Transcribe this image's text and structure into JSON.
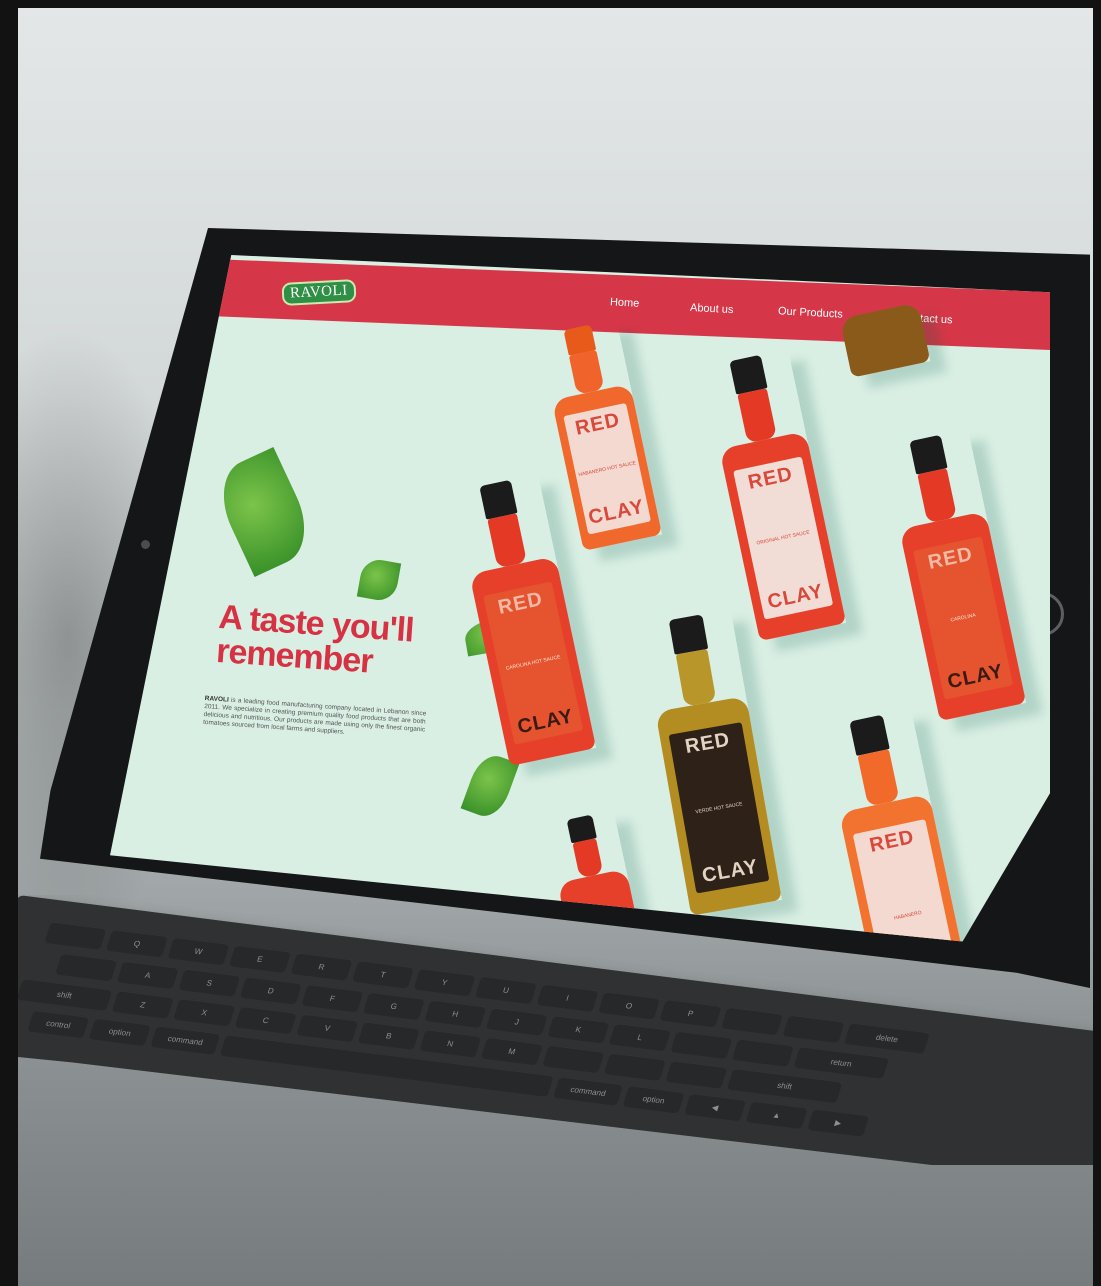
{
  "site": {
    "logo_text": "RAVOLI",
    "nav": [
      "Home",
      "About us",
      "Our Products",
      "Contact us"
    ],
    "hero": {
      "headline_line1": "A taste you'll",
      "headline_line2": "remember",
      "brand_name": "RAVOLI",
      "description": " is a leading food manufacturing company located in Lebanon since 2011. We specialize in creating premium quality food products that are both delicious and nutritious. Our products are made using only the finest organic tomatoes sourced from local farms and suppliers."
    },
    "bottles": [
      {
        "brand_top": "RED",
        "brand_bottom": "CLAY",
        "flavor": "HABANERO HOT SAUCE"
      },
      {
        "brand_top": "RED",
        "brand_bottom": "CLAY",
        "flavor": "ORIGINAL HOT SAUCE"
      },
      {
        "brand_top": "RED",
        "brand_bottom": "CLAY",
        "flavor": "CAROLINA HOT SAUCE"
      },
      {
        "brand_top": "RED",
        "brand_bottom": "CLAY",
        "flavor": "VERDE HOT SAUCE"
      },
      {
        "brand_top": "RED",
        "brand_bottom": "CLAY",
        "flavor": "CAROLINA"
      },
      {
        "brand_top": "RED",
        "brand_bottom": "",
        "flavor": "HABANERO"
      }
    ]
  },
  "keyboard": {
    "rows": [
      [
        "",
        "Q",
        "W",
        "E",
        "R",
        "T",
        "Y",
        "U",
        "I",
        "O",
        "P",
        "",
        "",
        "delete"
      ],
      [
        "",
        "A",
        "S",
        "D",
        "F",
        "G",
        "H",
        "J",
        "K",
        "L",
        "",
        "",
        "return"
      ],
      [
        "shift",
        "Z",
        "X",
        "C",
        "V",
        "B",
        "N",
        "M",
        "",
        "",
        "",
        "shift"
      ],
      [
        "control",
        "option",
        "command",
        "",
        "command",
        "option",
        "◀",
        "▲",
        "▶"
      ]
    ]
  },
  "colors": {
    "brand_red": "#d63748",
    "screen_bg": "#d9efe4",
    "leaf_green": "#2f8a24",
    "logo_green": "#2f8f45"
  }
}
